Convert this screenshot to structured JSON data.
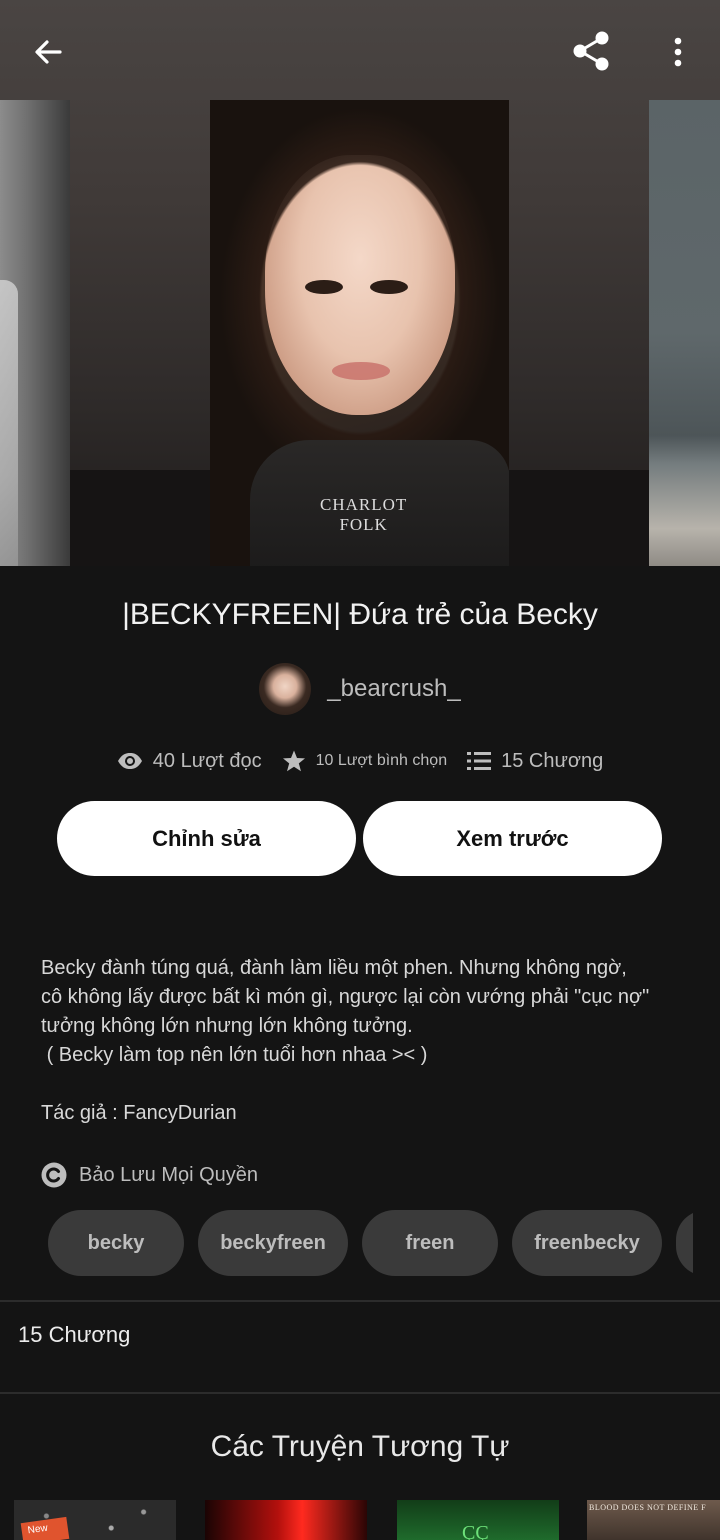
{
  "header": {
    "back_icon": "arrow-left-icon",
    "share_icon": "share-icon",
    "more_icon": "more-vertical-icon"
  },
  "cover": {
    "shirt_text_line1": "CHARLOT",
    "shirt_text_line2": "FOLK"
  },
  "story": {
    "title": "|BECKYFREEN| Đứa trẻ của Becky",
    "author": "_bearcrush_",
    "stats": {
      "reads": "40 Lượt đọc",
      "votes": "10 Lượt bình chọn",
      "parts": "15 Chương"
    },
    "description": "Becky đành túng quá, đành làm liều một phen. Nhưng không ngờ,\ncô không lấy được bất kì món gì, ngược lại còn vướng phải \"cục nợ\"\ntưởng không lớn nhưng lớn không tưởng.\n ( Becky làm top nên lớn tuổi hơn nhaa >< )\n\nTác giả : FancyDurian",
    "copyright": "Bảo Lưu Mọi Quyền",
    "tags": [
      "becky",
      "beckyfreen",
      "freen",
      "freenbecky"
    ]
  },
  "actions": {
    "edit_label": "Chỉnh sửa",
    "preview_label": "Xem trước"
  },
  "parts_section": {
    "heading": "15 Chương"
  },
  "similar": {
    "heading": "Các Truyện Tương Tự",
    "thumb1_badge": "New",
    "thumb3_text": "ÇÇ",
    "thumb4_text": "BLOOD DOES NOT DEFINE F"
  },
  "colors": {
    "background": "#141414",
    "button_bg": "#ffffff",
    "tag_bg": "#3a3a3a",
    "muted_text": "#bdbdbd"
  }
}
